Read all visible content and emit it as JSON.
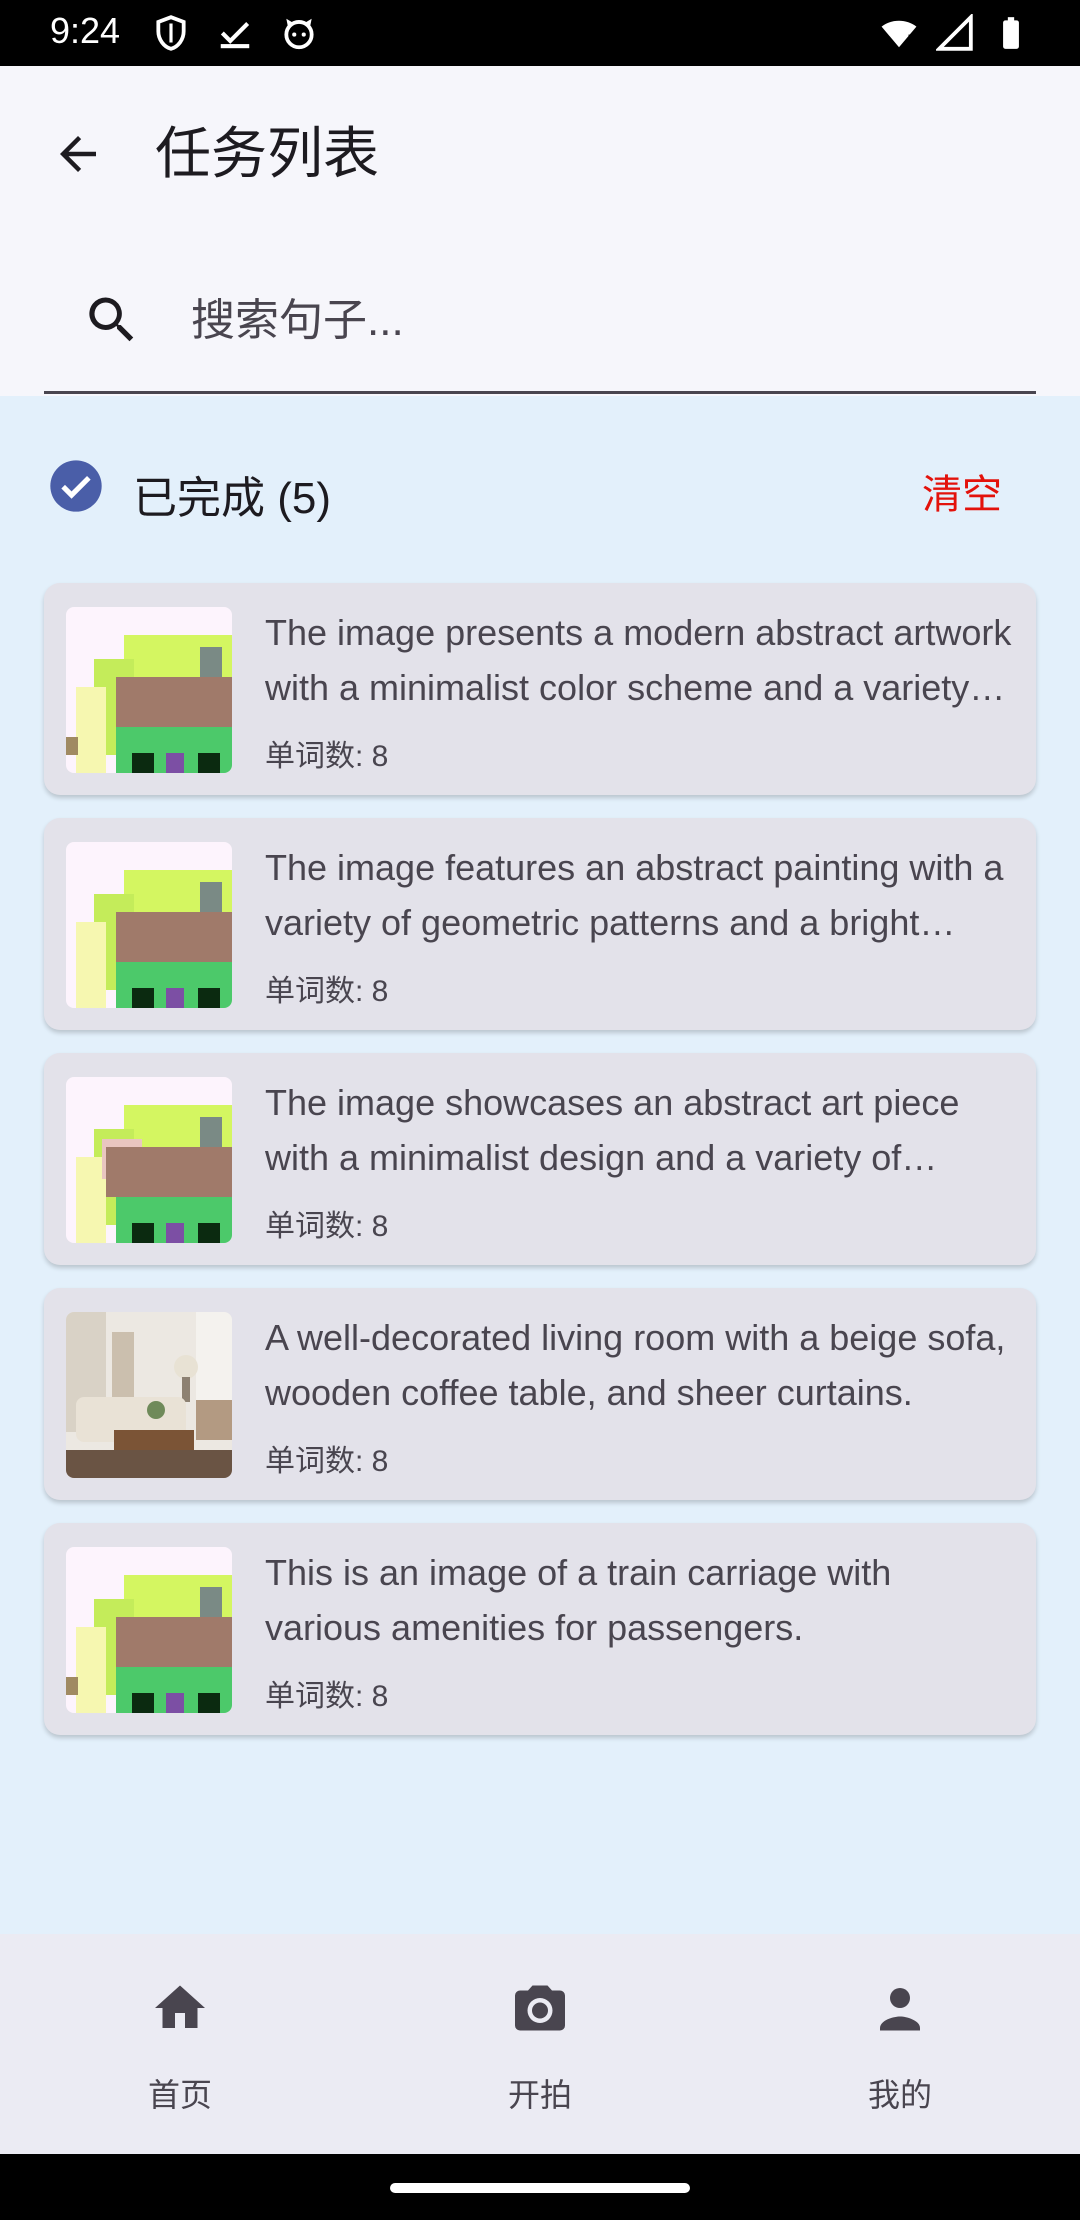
{
  "status_bar": {
    "time": "9:24"
  },
  "app_bar": {
    "title": "任务列表"
  },
  "search": {
    "placeholder": "搜索句子..."
  },
  "section": {
    "label": "已完成 (5)",
    "clear_label": "清空"
  },
  "tasks": [
    {
      "description": "The image presents a modern abstract artwork with a minimalist color scheme and a variety of shapes.",
      "word_count": "单词数: 8",
      "thumb": "abstract"
    },
    {
      "description": "The image features an abstract painting with a variety of geometric patterns and a bright palette.",
      "word_count": "单词数: 8",
      "thumb": "abstract"
    },
    {
      "description": "The image showcases an abstract art piece with a minimalist design and a variety of colors.",
      "word_count": "单词数: 8",
      "thumb": "abstract"
    },
    {
      "description": "A well-decorated living room with a beige sofa, wooden coffee table, and sheer curtains.",
      "word_count": "单词数: 8",
      "thumb": "living-room"
    },
    {
      "description": "This is an image of a train carriage with various amenities for passengers.",
      "word_count": "单词数: 8",
      "thumb": "abstract"
    }
  ],
  "bottom_nav": {
    "items": [
      {
        "label": "首页",
        "icon": "home-icon"
      },
      {
        "label": "开拍",
        "icon": "camera-icon"
      },
      {
        "label": "我的",
        "icon": "person-icon"
      }
    ]
  },
  "colors": {
    "accent": "#4a5ea8",
    "clear": "#e3120b",
    "background": "#e3f0fb"
  }
}
